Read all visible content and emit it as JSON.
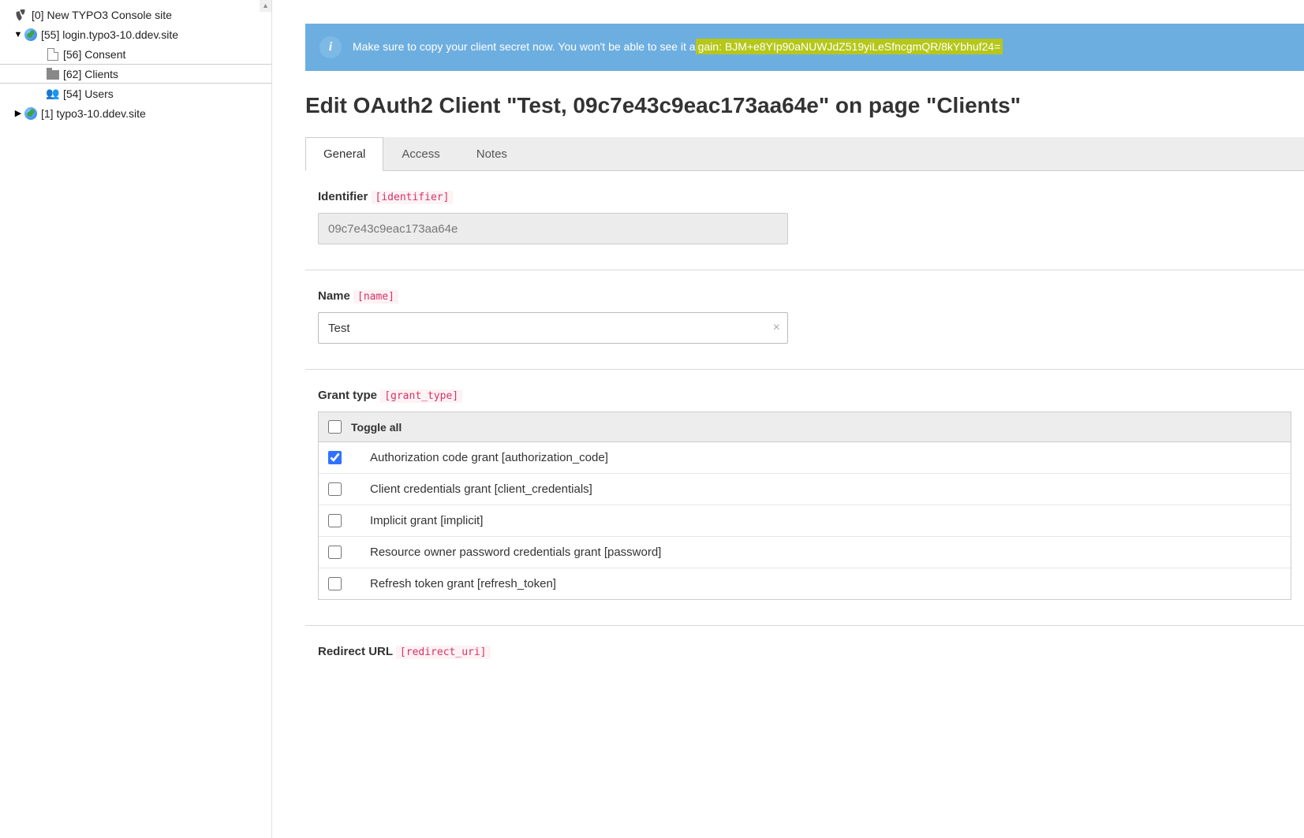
{
  "tree": {
    "root": {
      "label": "[0] New TYPO3 Console site"
    },
    "site1": {
      "label": "[55] login.typo3-10.ddev.site"
    },
    "consent": {
      "label": "[56] Consent"
    },
    "clients": {
      "label": "[62] Clients"
    },
    "users": {
      "label": "[54] Users"
    },
    "site2": {
      "label": "[1] typo3-10.ddev.site"
    }
  },
  "alert": {
    "prefix": "Make sure to copy your client secret now. You won't be able to see it a",
    "highlighted": "gain: BJM+e8YIp90aNUWJdZ519yiLeSfncgmQR/8kYbhuf24="
  },
  "page_title": "Edit OAuth2 Client \"Test, 09c7e43c9eac173aa64e\" on page \"Clients\"",
  "tabs": {
    "general": "General",
    "access": "Access",
    "notes": "Notes"
  },
  "fields": {
    "identifier": {
      "label": "Identifier",
      "code": "[identifier]",
      "value": "09c7e43c9eac173aa64e"
    },
    "name": {
      "label": "Name",
      "code": "[name]",
      "value": "Test"
    },
    "grant_type": {
      "label": "Grant type",
      "code": "[grant_type]",
      "toggle_all": "Toggle all"
    },
    "redirect_uri": {
      "label": "Redirect URL",
      "code": "[redirect_uri]"
    }
  },
  "grant_options": [
    {
      "label": "Authorization code grant [authorization_code]",
      "checked": true
    },
    {
      "label": "Client credentials grant [client_credentials]",
      "checked": false
    },
    {
      "label": "Implicit grant [implicit]",
      "checked": false
    },
    {
      "label": "Resource owner password credentials grant [password]",
      "checked": false
    },
    {
      "label": "Refresh token grant [refresh_token]",
      "checked": false
    }
  ]
}
